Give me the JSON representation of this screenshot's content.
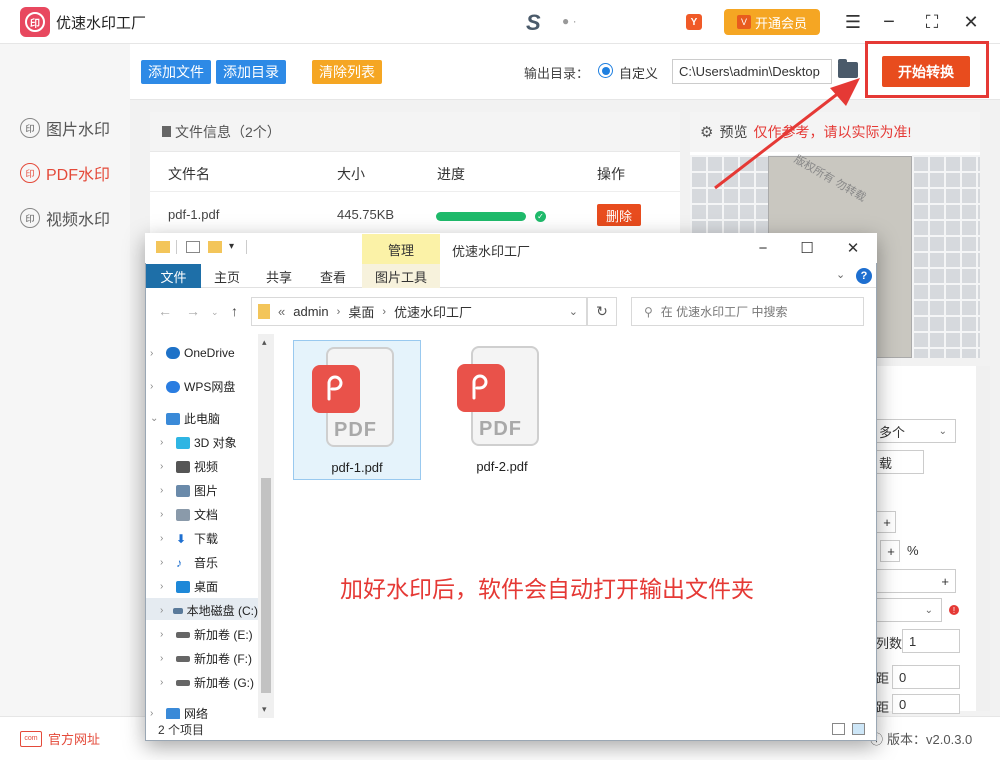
{
  "app": {
    "title": "优速水印工厂",
    "logo_glyph": "印",
    "vip_label": "开通会员",
    "vip_badge": "V",
    "y_badge": "Y"
  },
  "window_controls": {
    "menu": "☰",
    "maximize": "⛶",
    "close": "✕"
  },
  "sidebar": {
    "items": [
      {
        "label": "图片水印",
        "active": false
      },
      {
        "label": "PDF水印",
        "active": true
      },
      {
        "label": "视频水印",
        "active": false
      }
    ]
  },
  "toolbar": {
    "add_file": "添加文件",
    "add_folder": "添加目录",
    "clear_list": "清除列表",
    "output_label": "输出目录：",
    "radio_label": "自定义",
    "output_path": "C:\\Users\\admin\\Desktop",
    "start_button": "开始转换"
  },
  "file_panel": {
    "header": "文件信息（2个）",
    "columns": [
      "文件名",
      "大小",
      "进度",
      "操作"
    ],
    "rows": [
      {
        "name": "pdf-1.pdf",
        "size": "445.75KB",
        "progress": 1.0,
        "action": "删除"
      }
    ]
  },
  "preview": {
    "label": "预览",
    "note": "仅作参考，请以实际为准!",
    "watermark": "版权所有 勿转载"
  },
  "settings_fragments": {
    "multi": "多个",
    "char1": "载",
    "pct": "%",
    "cols_label": "列数",
    "cols_value": "1",
    "spacing1_label": "距",
    "spacing1_value": "0",
    "spacing2_label": "距",
    "spacing2_value": "0"
  },
  "footer": {
    "website": "官方网址",
    "version": "版本：v2.0.3.0"
  },
  "explorer": {
    "manage_tab": "管理",
    "window_title": "优速水印工厂",
    "tabs": [
      "文件",
      "主页",
      "共享",
      "查看",
      "图片工具"
    ],
    "address": [
      "admin",
      "桌面",
      "优速水印工厂"
    ],
    "search_placeholder": "在 优速水印工厂 中搜索",
    "tree": [
      {
        "label": "OneDrive",
        "color": "#1e72c8"
      },
      {
        "label": "WPS网盘",
        "color": "#2a7de1"
      },
      {
        "label": "此电脑",
        "color": "#3a8ad8"
      },
      {
        "label": "3D 对象",
        "color": "#2fb5e3"
      },
      {
        "label": "视频",
        "color": "#555555"
      },
      {
        "label": "图片",
        "color": "#6a8aaa"
      },
      {
        "label": "文档",
        "color": "#8a9aaa"
      },
      {
        "label": "下载",
        "color": "#1e6fd0"
      },
      {
        "label": "音乐",
        "color": "#1e6fd0"
      },
      {
        "label": "桌面",
        "color": "#1e88d8"
      },
      {
        "label": "本地磁盘 (C:)",
        "color": "#5a7a9a"
      },
      {
        "label": "新加卷 (E:)",
        "color": "#666666"
      },
      {
        "label": "新加卷 (F:)",
        "color": "#666666"
      },
      {
        "label": "新加卷 (G:)",
        "color": "#666666"
      },
      {
        "label": "网络",
        "color": "#3a8ad8"
      }
    ],
    "files": [
      {
        "name": "pdf-1.pdf",
        "selected": true
      },
      {
        "name": "pdf-2.pdf",
        "selected": false
      }
    ],
    "pdf_label": "PDF",
    "status": "2 个项目"
  },
  "overlay_caption": "加好水印后，软件会自动打开输出文件夹",
  "colors": {
    "accent_red": "#e84c1e",
    "highlight_box": "#e53935",
    "button_blue": "#2e8ae6",
    "button_orange": "#f5a623",
    "progress_green": "#1fba6b"
  }
}
